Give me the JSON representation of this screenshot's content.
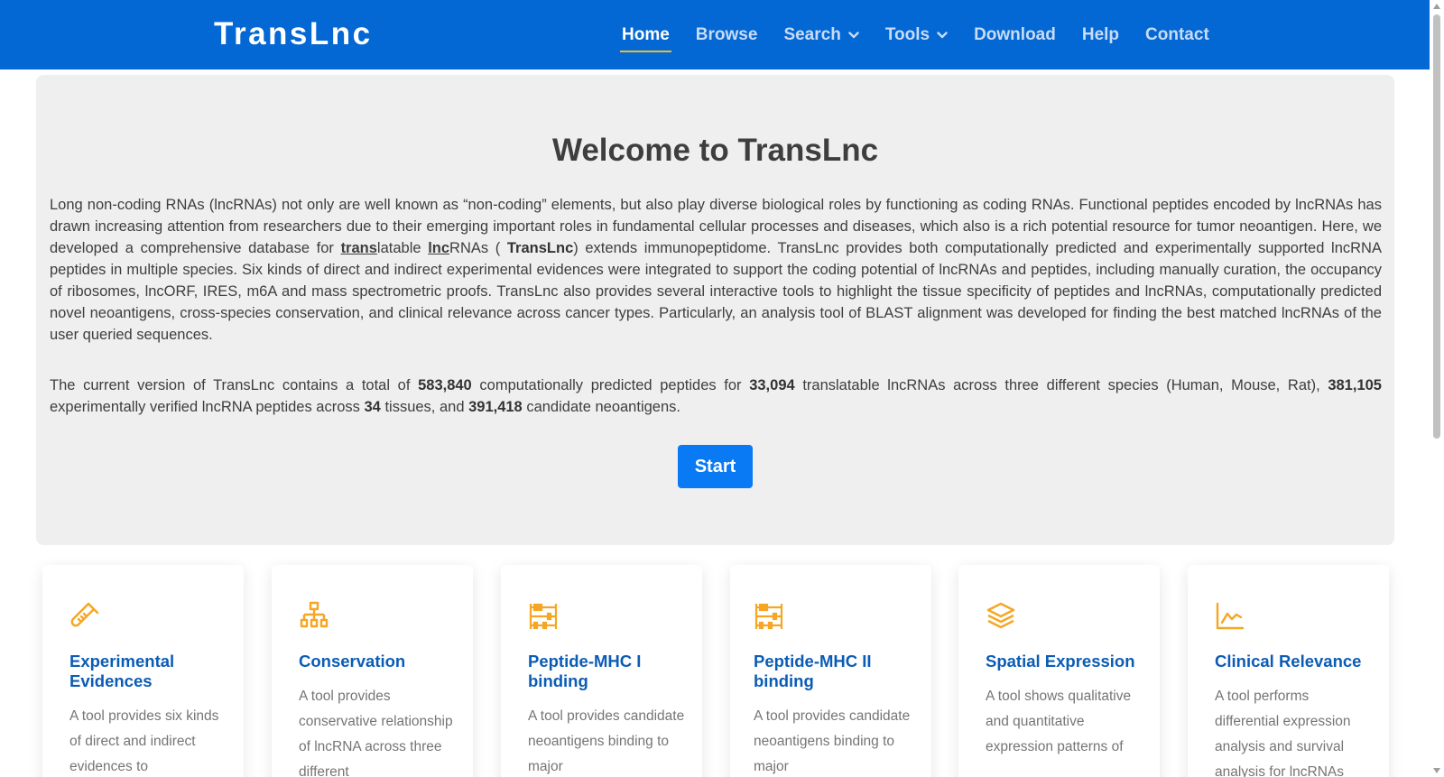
{
  "navbar": {
    "brand": "TransLnc",
    "items": [
      {
        "label": "Home",
        "active": true,
        "dropdown": false
      },
      {
        "label": "Browse",
        "active": false,
        "dropdown": false
      },
      {
        "label": "Search",
        "active": false,
        "dropdown": true
      },
      {
        "label": "Tools",
        "active": false,
        "dropdown": true
      },
      {
        "label": "Download",
        "active": false,
        "dropdown": false
      },
      {
        "label": "Help",
        "active": false,
        "dropdown": false
      },
      {
        "label": "Contact",
        "active": false,
        "dropdown": false
      }
    ]
  },
  "hero": {
    "title": "Welcome to TransLnc",
    "p1_a": "Long non-coding RNAs (lncRNAs) not only are well known as “non-coding” elements, but also play diverse biological roles by functioning as coding RNAs. Functional peptides encoded by lncRNAs has drawn increasing attention from researchers due to their emerging important roles in fundamental cellular processes and diseases, which also is a rich potential resource for tumor neoantigen. Here, we developed a comprehensive database for ",
    "p1_trans": "trans",
    "p1_b": "latable ",
    "p1_lnc": "lnc",
    "p1_c": "RNAs ( ",
    "p1_name": "TransLnc",
    "p1_d": ") extends immunopeptidome. TransLnc provides both computationally predicted and experimentally supported lncRNA peptides in multiple species. Six kinds of direct and indirect experimental evidences were integrated to support the coding potential of lncRNAs and peptides, including manually curation, the occupancy of ribosomes, lncORF, IRES, m6A and mass spectrometric proofs. TransLnc also provides several interactive tools to highlight the tissue specificity of peptides and lncRNAs, computationally predicted novel neoantigens, cross-species conservation, and clinical relevance across cancer types. Particularly, an analysis tool of BLAST alignment was developed for finding the best matched lncRNAs of the user queried sequences.",
    "p2_a": "The current version of TransLnc contains a total of ",
    "n_peptides": "583,840",
    "p2_b": " computationally predicted peptides for ",
    "n_lncrnas": "33,094",
    "p2_c": " translatable lncRNAs across three different species (Human, Mouse, Rat), ",
    "n_verified": "381,105",
    "p2_d": " experimentally verified lncRNA peptides across ",
    "n_tissues": "34",
    "p2_e": " tissues, and ",
    "n_neoantigens": "391,418",
    "p2_f": " candidate neoantigens.",
    "start_label": "Start"
  },
  "accent_color": "#f5a623",
  "cards": [
    {
      "icon": "test-tube-icon",
      "title": "Experimental Evidences",
      "text": "A tool provides six kinds of direct and indirect evidences to"
    },
    {
      "icon": "hierarchy-icon",
      "title": "Conservation",
      "text": "A tool provides conservative relationship of lncRNA across three different"
    },
    {
      "icon": "abacus-icon",
      "title": "Peptide-MHC I binding",
      "text": "A tool provides candidate neoantigens binding to major"
    },
    {
      "icon": "abacus-icon",
      "title": "Peptide-MHC II binding",
      "text": "A tool provides candidate neoantigens binding to major"
    },
    {
      "icon": "layers-icon",
      "title": "Spatial Expression",
      "text": "A tool shows qualitative and quantitative expression patterns of"
    },
    {
      "icon": "line-chart-icon",
      "title": "Clinical Relevance",
      "text": "A tool performs differential expression analysis and survival analysis for lncRNAs"
    }
  ]
}
